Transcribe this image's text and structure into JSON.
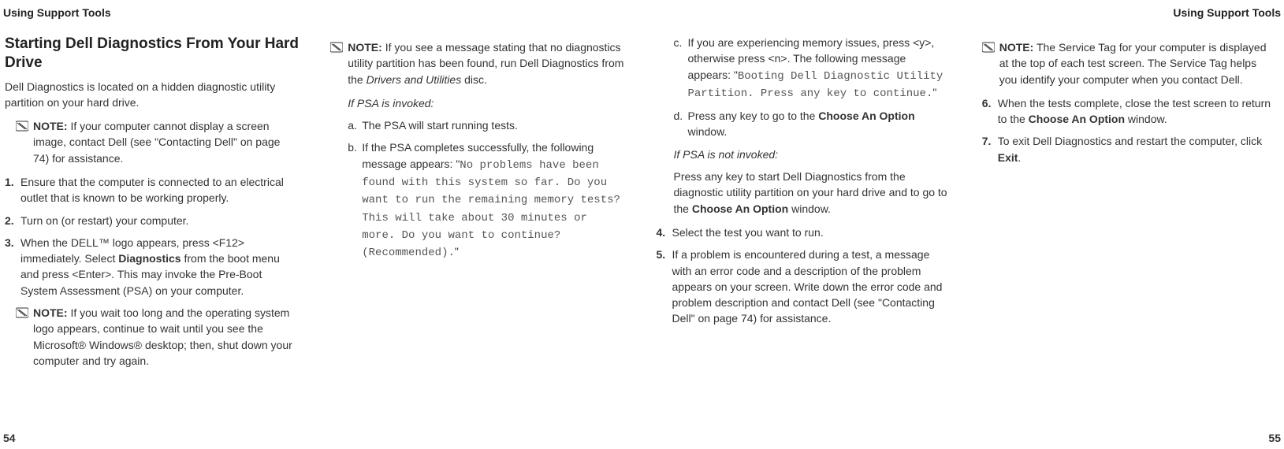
{
  "header": {
    "left": "Using Support Tools",
    "right": "Using Support Tools"
  },
  "footer": {
    "left": "54",
    "right": "55"
  },
  "col1": {
    "title": "Starting Dell Diagnostics From Your Hard Drive",
    "intro": "Dell Diagnostics is located on a hidden diagnostic utility partition on your hard drive.",
    "note1": {
      "label": "NOTE:",
      "text": " If your computer cannot display a screen image, contact Dell (see \"Contacting Dell\" on page 74) for assistance."
    },
    "step1": "Ensure that the computer is connected to an electrical outlet that is known to be working properly.",
    "step2": "Turn on (or restart) your computer.",
    "step3_a": "When the DELL™ logo appears, press <F12> immediately. Select ",
    "step3_b": "Diagnostics",
    "step3_c": " from the boot menu and press <Enter>. This may invoke the Pre-Boot System Assessment (PSA) on your computer.",
    "note2": {
      "label": "NOTE:",
      "text": " If you wait too long and the operating system logo appears, continue to wait until you see the Microsoft® Windows® desktop; then, shut down your computer and try again."
    }
  },
  "col2": {
    "note3": {
      "label": "NOTE:",
      "text_a": " If you see a message stating that no diagnostics utility partition has been found, run Dell Diagnostics from the ",
      "text_b": "Drivers and Utilities",
      "text_c": " disc."
    },
    "psa_heading": "If PSA is invoked:",
    "sub_a": "The PSA will start running tests.",
    "sub_b_pre": "If the PSA completes successfully, the following message appears: \"",
    "sub_b_mono": "No problems have been found with this system so far. Do you want to run the remaining memory tests? This will take about 30 minutes or more. Do you want to continue? (Recommended).",
    "sub_b_post": "\""
  },
  "col3": {
    "sub_c_pre": "If you are experiencing memory issues, press <y>, otherwise press <n>. The following message appears: \"",
    "sub_c_mono": "Booting Dell Diagnostic Utility Partition. Press any key to continue.",
    "sub_c_post": "\"",
    "sub_d_a": "Press any key to go to the ",
    "sub_d_b": "Choose An Option",
    "sub_d_c": " window.",
    "psa_not_heading": "If PSA is not invoked:",
    "psa_not_a": "Press any key to start Dell Diagnostics from the diagnostic utility partition on your hard drive and to go to the ",
    "psa_not_b": "Choose An Option",
    "psa_not_c": " window.",
    "step4": "Select the test you want to run.",
    "step5": "If a problem is encountered during a test, a message with an error code and a description of the problem appears on your screen. Write down the error code and problem description and contact Dell (see \"Contacting Dell\" on page 74) for assistance."
  },
  "col4": {
    "note4": {
      "label": "NOTE:",
      "text": " The Service Tag for your computer is displayed at the top of each test screen. The Service Tag helps you identify your computer when you contact Dell."
    },
    "step6_a": "When the tests complete, close the test screen to return to the ",
    "step6_b": "Choose An Option",
    "step6_c": " window.",
    "step7_a": "To exit Dell Diagnostics and restart the computer, click ",
    "step7_b": "Exit",
    "step7_c": "."
  },
  "markers": {
    "a": "a.",
    "b": "b.",
    "c": "c.",
    "d": "d.",
    "n4": "4.",
    "n5": "5.",
    "n6": "6.",
    "n7": "7."
  }
}
